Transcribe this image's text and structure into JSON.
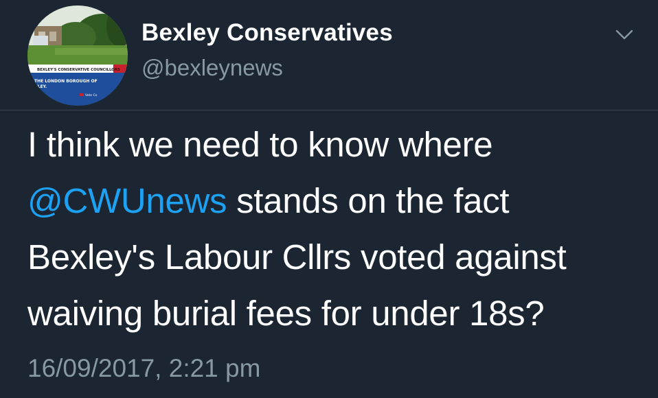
{
  "profile": {
    "display_name": "Bexley Conservatives",
    "handle": "@bexleynews",
    "avatar": {
      "banner_line_1": "BEXLEY'S CONSERVATIVE COUNCILLORS",
      "banner_line_2": "THE LONDON BOROUGH OF",
      "banner_line_3": "XLEY.",
      "banner_line_4": "Vote Co",
      "colors": {
        "sky": "#dfe6dc",
        "trees": "#2f5a22",
        "grass": "#5d8f35",
        "banner": "#1f4f9c",
        "banner_red": "#c8202c"
      }
    }
  },
  "menu": {
    "icon": "chevron-down-icon"
  },
  "tweet": {
    "line1": "I think we need to know where",
    "mention": "@CWUnews",
    "line2_rest": " stands on the fact",
    "line3": "Bexley's Labour Cllrs voted against",
    "line4": "waiving burial fees for under 18s?",
    "timestamp": "16/09/2017, 2:21 pm"
  },
  "colors": {
    "background": "#1c2532",
    "text": "#ffffff",
    "secondary_text": "#8899a6",
    "mention": "#1da1f2",
    "divider": "#38444d"
  }
}
